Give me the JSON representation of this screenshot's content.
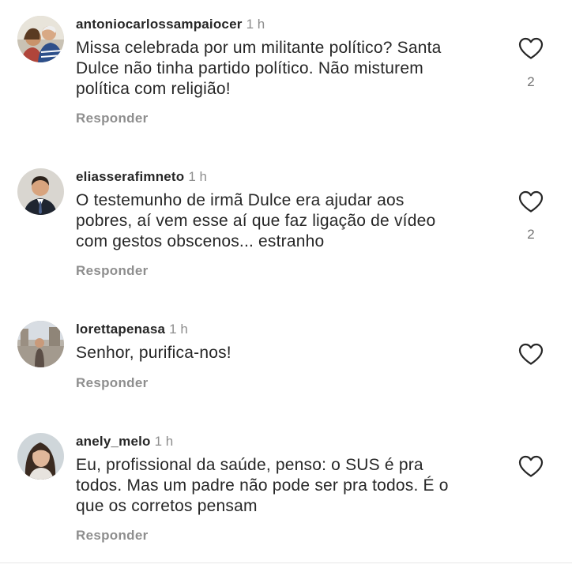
{
  "comments": [
    {
      "username": "antoniocarlossampaiocer",
      "time": "1 h",
      "text_lines": [
        "Missa celebrada por um militante político? Santa",
        "Dulce não tinha partido político. Não misturem",
        "política com religião!"
      ],
      "reply_label": "Responder",
      "like_count": "2",
      "like_icon": "heart-outline-icon"
    },
    {
      "username": "eliasserafimneto",
      "time": "1 h",
      "text_lines": [
        "O testemunho de irmã Dulce era ajudar aos",
        "pobres, aí vem esse aí que faz ligação de vídeo",
        "com gestos obscenos... estranho"
      ],
      "reply_label": "Responder",
      "like_count": "2",
      "like_icon": "heart-outline-icon"
    },
    {
      "username": "lorettapenasa",
      "time": "1 h",
      "text_lines": [
        "Senhor, purifica-nos!"
      ],
      "reply_label": "Responder",
      "like_icon": "heart-outline-icon"
    },
    {
      "username": "anely_melo",
      "time": "1 h",
      "text_lines": [
        "Eu, profissional da saúde, penso: o SUS é pra",
        "todos. Mas um padre não pode ser pra todos. É o",
        "que os corretos pensam"
      ],
      "reply_label": "Responder",
      "like_icon": "heart-outline-icon"
    }
  ],
  "colors": {
    "text": "#262626",
    "secondary": "#8e8e8e",
    "icon": "#262626"
  }
}
